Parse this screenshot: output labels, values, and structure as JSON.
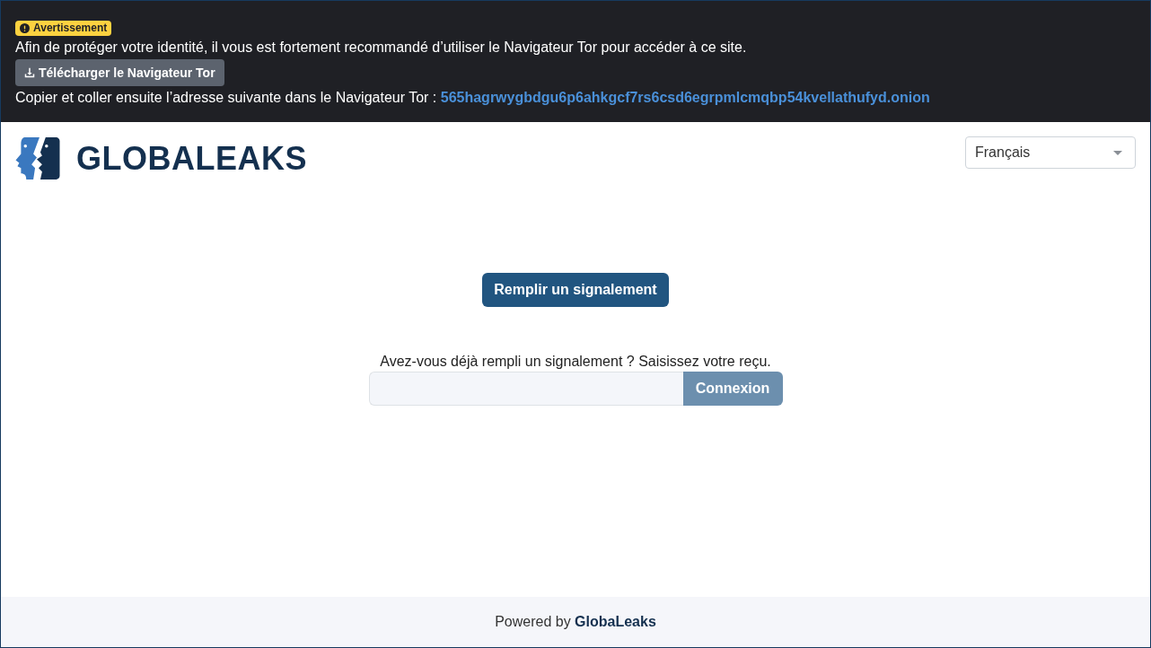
{
  "warning": {
    "badge": "Avertissement",
    "message": "Afin de protéger votre identité, il vous est fortement recommandé d’utiliser le Navigateur Tor pour accéder à ce site.",
    "download_button": "Télécharger le Navigateur Tor",
    "copy_text": "Copier et coller ensuite l’adresse suivante dans le Navigateur Tor :",
    "onion_address": "565hagrwygbdgu6p6ahkgcf7rs6csd6egrpmlcmqbp54kvellathufyd.onion"
  },
  "header": {
    "logo_text": "GLOBALEAKS",
    "language_select": {
      "value": "Français"
    }
  },
  "main": {
    "submit_button": "Remplir un signalement",
    "receipt_prompt": "Avez-vous déjà rempli un signalement ? Saisissez votre reçu.",
    "login_button": "Connexion"
  },
  "footer": {
    "text": "Powered by **GlobaLeaks**"
  }
}
